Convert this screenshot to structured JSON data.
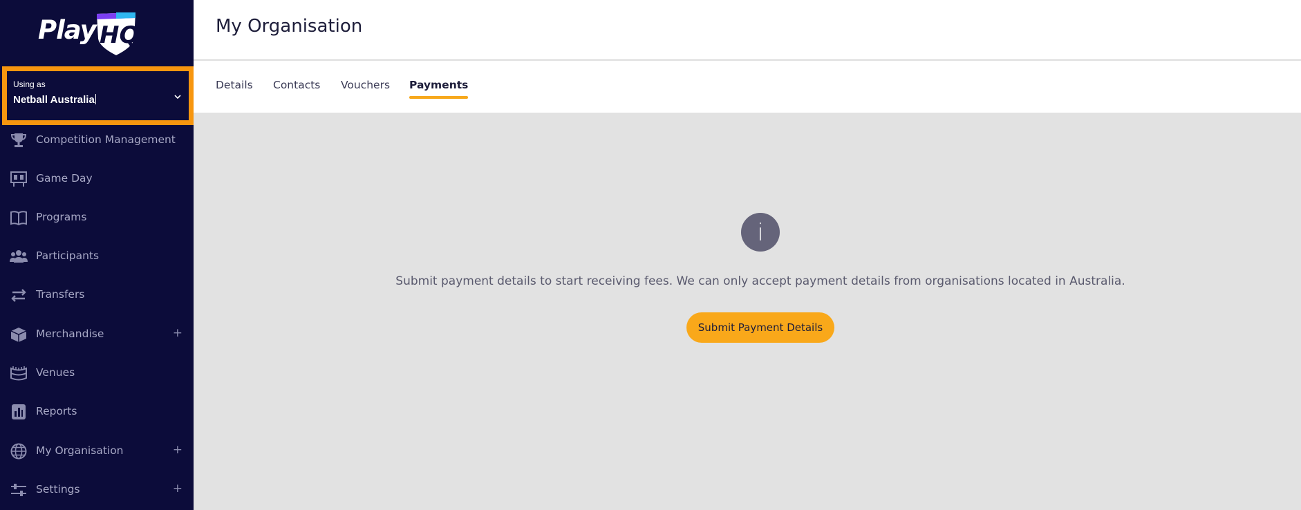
{
  "brand": {
    "logo_text": "Play",
    "logo_mark": "HQ",
    "accent": "#f7a81b",
    "sidebar_bg": "#0c0c3a"
  },
  "org_select": {
    "label": "Using as",
    "value": "Netball Australia",
    "icon": "chevron-down-icon"
  },
  "sidebar": {
    "items": [
      {
        "label": "Competition Management",
        "icon": "trophy-icon",
        "expandable": false
      },
      {
        "label": "Game Day",
        "icon": "scoreboard-icon",
        "expandable": false
      },
      {
        "label": "Programs",
        "icon": "book-icon",
        "expandable": false
      },
      {
        "label": "Participants",
        "icon": "people-icon",
        "expandable": false
      },
      {
        "label": "Transfers",
        "icon": "transfer-arrows-icon",
        "expandable": false
      },
      {
        "label": "Merchandise",
        "icon": "box-icon",
        "expandable": true,
        "expand_symbol": "+"
      },
      {
        "label": "Venues",
        "icon": "stadium-icon",
        "expandable": false
      },
      {
        "label": "Reports",
        "icon": "report-icon",
        "expandable": false
      },
      {
        "label": "My Organisation",
        "icon": "globe-icon",
        "expandable": true,
        "expand_symbol": "+"
      },
      {
        "label": "Settings",
        "icon": "sliders-icon",
        "expandable": true,
        "expand_symbol": "+"
      }
    ]
  },
  "header": {
    "title": "My Organisation"
  },
  "tabs": [
    {
      "label": "Details",
      "active": false
    },
    {
      "label": "Contacts",
      "active": false
    },
    {
      "label": "Vouchers",
      "active": false
    },
    {
      "label": "Payments",
      "active": true
    }
  ],
  "main": {
    "info_icon": "info-icon",
    "info_glyph": "i",
    "message": "Submit payment details to start receiving fees. We can only accept payment details from organisations located in Australia.",
    "button_label": "Submit Payment Details"
  }
}
